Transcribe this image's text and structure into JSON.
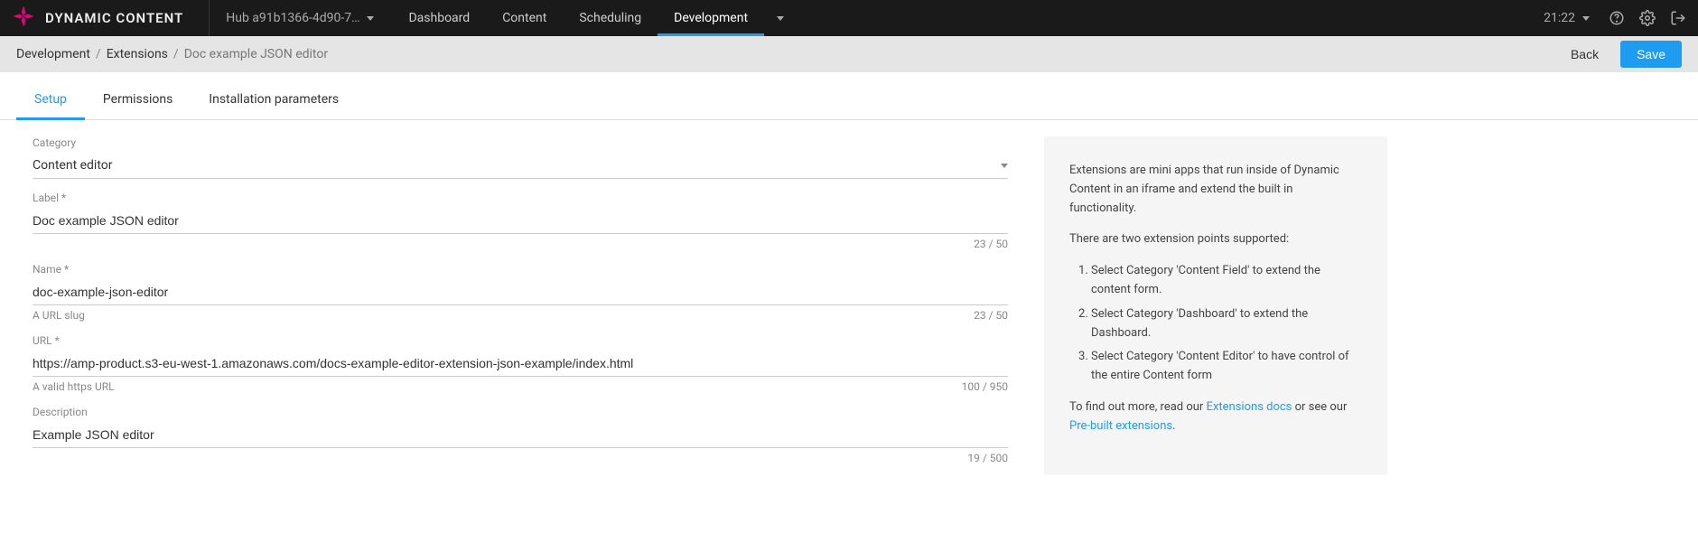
{
  "brand": "DYNAMIC CONTENT",
  "hub": {
    "label": "Hub a91b1366-4d90-7…"
  },
  "nav": {
    "items": [
      "Dashboard",
      "Content",
      "Scheduling",
      "Development"
    ],
    "activeIndex": 3
  },
  "topbar": {
    "time": "21:22"
  },
  "breadcrumb": {
    "items": [
      "Development",
      "Extensions"
    ],
    "current": "Doc example JSON editor"
  },
  "actions": {
    "back": "Back",
    "save": "Save"
  },
  "tabs": {
    "items": [
      "Setup",
      "Permissions",
      "Installation parameters"
    ],
    "activeIndex": 0
  },
  "form": {
    "category": {
      "label": "Category",
      "value": "Content editor"
    },
    "label": {
      "label": "Label *",
      "value": "Doc example JSON editor",
      "counter": "23 / 50"
    },
    "name": {
      "label": "Name *",
      "value": "doc-example-json-editor",
      "hint": "A URL slug",
      "counter": "23 / 50"
    },
    "url": {
      "label": "URL *",
      "value": "https://amp-product.s3-eu-west-1.amazonaws.com/docs-example-editor-extension-json-example/index.html",
      "hint": "A valid https URL",
      "counter": "100 / 950"
    },
    "description": {
      "label": "Description",
      "value": "Example JSON editor",
      "counter": "19 / 500"
    }
  },
  "panel": {
    "p1": "Extensions are mini apps that run inside of Dynamic Content in an iframe and extend the built in functionality.",
    "p2": "There are two extension points supported:",
    "li1": "Select Category 'Content Field' to extend the content form.",
    "li2": "Select Category 'Dashboard' to extend the Dashboard.",
    "li3": "Select Category 'Content Editor' to have control of the entire Content form",
    "p3a": "To find out more, read our ",
    "link1": "Extensions docs",
    "p3b": " or see our ",
    "link2": "Pre-built extensions",
    "p3c": "."
  }
}
